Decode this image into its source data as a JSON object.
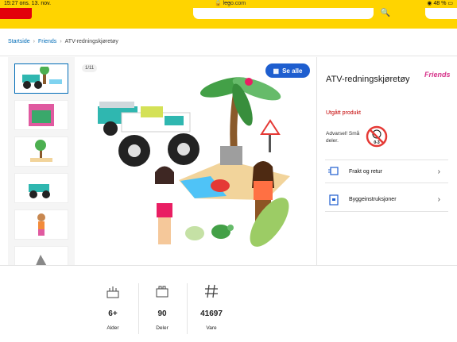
{
  "status_bar": {
    "time": "15:27",
    "date": "ons. 13. nov.",
    "url": "lego.com",
    "battery": "48 %"
  },
  "breadcrumb": {
    "home": "Startside",
    "category": "Friends",
    "current": "ATV-redningskjøretøy"
  },
  "gallery": {
    "counter": "1/11",
    "see_all_label": "Se alle"
  },
  "product": {
    "title": "ATV-redningskjøretøy",
    "brand": "Friends",
    "availability": "Utgått produkt",
    "warning": "Advarsel! Små deler.",
    "age_badge_text": "0-3"
  },
  "links": [
    {
      "label": "Frakt og retur",
      "icon": "truck-box-icon"
    },
    {
      "label": "Byggeinstruksjoner",
      "icon": "instructions-icon"
    }
  ],
  "stats": [
    {
      "value": "6+",
      "label": "Alder",
      "icon": "cake-icon"
    },
    {
      "value": "90",
      "label": "Deler",
      "icon": "brick-icon"
    },
    {
      "value": "41697",
      "label": "Vare",
      "icon": "hash-icon"
    }
  ],
  "colors": {
    "brand_yellow": "#ffd400",
    "lego_red": "#e3000b",
    "link_blue": "#006cb7",
    "button_blue": "#1e5ecf",
    "sold_out_red": "#c40000"
  }
}
